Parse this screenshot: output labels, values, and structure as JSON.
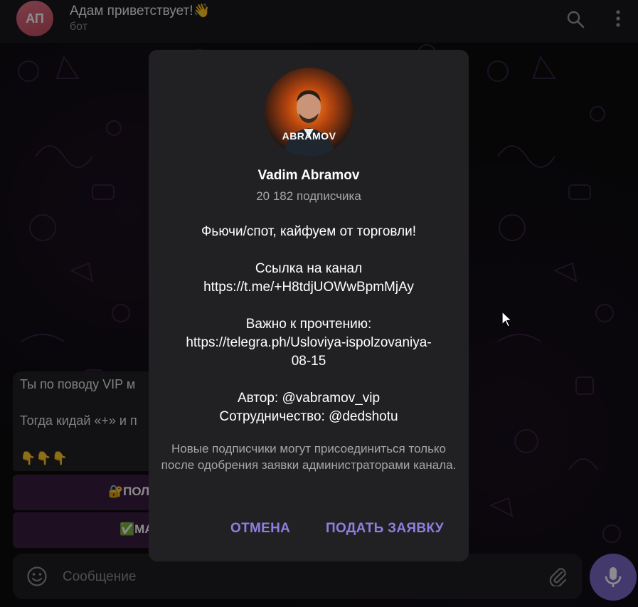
{
  "header": {
    "avatar_initials": "АП",
    "title": "Адам приветствует!👋",
    "subtitle": "бот",
    "icons": [
      "search-icon",
      "more-vertical-icon"
    ]
  },
  "chat": {
    "message": {
      "line1": "Ты по поводу VIP м",
      "line2": "Тогда кидай «+» и п",
      "line3": "👇👇👇"
    },
    "keyboard_buttons": [
      {
        "label": "🔐ПОЛ"
      },
      {
        "label": "✅МА"
      }
    ]
  },
  "composer": {
    "placeholder": "Сообщение",
    "icons": [
      "emoji-icon",
      "attach-icon",
      "mic-icon"
    ]
  },
  "dialog": {
    "avatar_text": "ABRAMOV",
    "channel_name": "Vadim Abramov",
    "subscribers": "20 182 подписчика",
    "description": [
      "Фьючи/спот, кайфуем от торговли!",
      "",
      "Ссылка на канал",
      "https://t.me/+H8tdjUOWwBpmMjAy",
      "",
      "Важно к прочтению:",
      "https://telegra.ph/Usloviya-ispolzovaniya-",
      "08-15",
      "",
      "Автор: @vabramov_vip",
      "Сотрудничество: @dedshotu"
    ],
    "note": "Новые подписчики могут присоединиться только после одобрения заявки администраторами канала.",
    "cancel_label": "ОТМЕНА",
    "join_label": "ПОДАТЬ ЗАЯВКУ"
  },
  "colors": {
    "accent": "#8d7fe0",
    "mic_button": "#7b69c7",
    "avatar": "#d65d73",
    "dialog_bg": "#212123"
  }
}
